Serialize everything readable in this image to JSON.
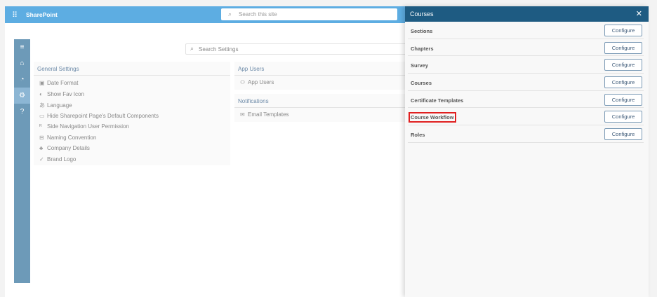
{
  "header": {
    "app_name": "SharePoint",
    "search_placeholder": "Search this site"
  },
  "nav": {
    "items": [
      "menu-icon",
      "home-icon",
      "palette-icon",
      "gear-icon",
      "help-icon"
    ],
    "active": "gear-icon"
  },
  "settings_search_placeholder": "Search Settings",
  "general": {
    "title": "General Settings",
    "items": [
      "Date Format",
      "Show Fav Icon",
      "Language",
      "Hide Sharepoint Page's Default Components",
      "Side Navigation User Permission",
      "Naming Convention",
      "Company Details",
      "Brand Logo"
    ]
  },
  "app_users": {
    "title": "App Users",
    "items": [
      "App Users"
    ]
  },
  "notifications": {
    "title": "Notifications",
    "items": [
      "Email Templates"
    ]
  },
  "panel": {
    "title": "Courses",
    "configure_label": "Configure",
    "rows": [
      "Sections",
      "Chapters",
      "Survey",
      "Courses",
      "Certificate Templates",
      "Course Workflow",
      "Roles"
    ],
    "highlighted": "Course Workflow"
  }
}
